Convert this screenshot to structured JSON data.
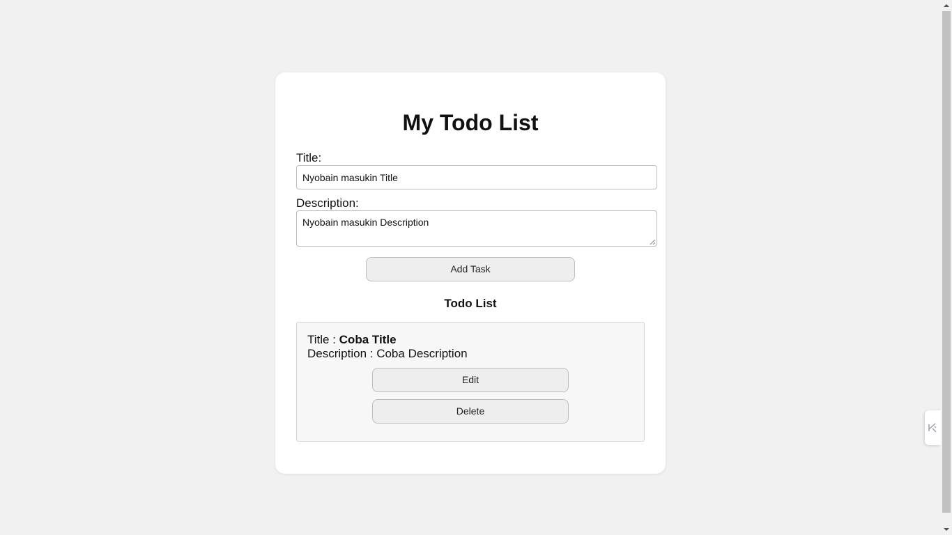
{
  "page": {
    "title": "My Todo List"
  },
  "form": {
    "title_label": "Title:",
    "title_value": "Nyobain masukin Title",
    "description_label": "Description:",
    "description_value": "Nyobain masukin Description",
    "add_button_label": "Add Task"
  },
  "todo_list": {
    "heading": "Todo List",
    "items": [
      {
        "title_prefix": "Title : ",
        "title": "Coba Title",
        "description_prefix": "Description : ",
        "description": "Coba Description",
        "edit_label": "Edit",
        "delete_label": "Delete"
      }
    ]
  },
  "icons": {
    "side_widget": "extension-launcher-icon",
    "resize": "resize-grip-icon"
  },
  "colors": {
    "background": "#f1f1f1",
    "card": "#ffffff",
    "button": "#eeeeee",
    "item_background": "#f7f7f7"
  }
}
